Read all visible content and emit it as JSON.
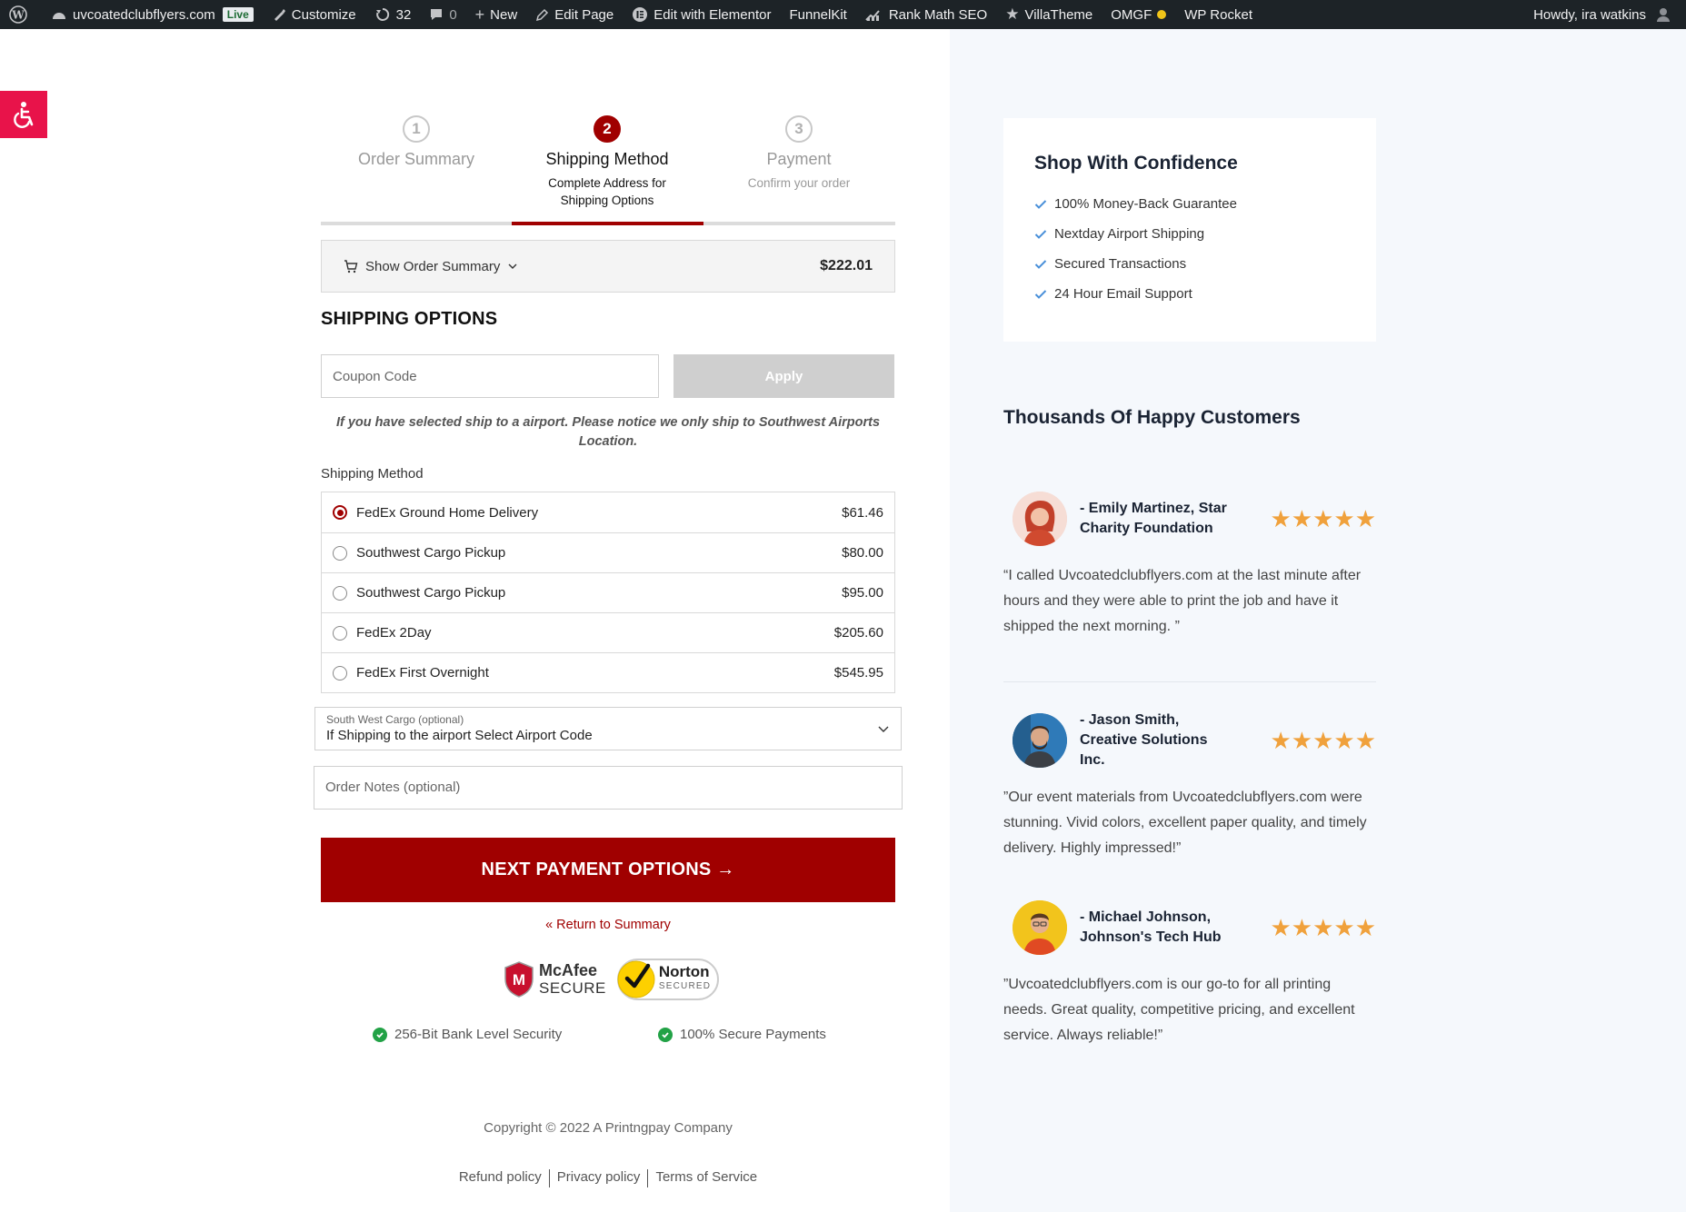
{
  "admin_bar": {
    "site_name": "uvcoatedclubflyers.com",
    "live_badge": "Live",
    "customize": "Customize",
    "updates_count": "32",
    "comments_count": "0",
    "new": "New",
    "edit_page": "Edit Page",
    "edit_elementor": "Edit with Elementor",
    "funnelkit": "FunnelKit",
    "rank_math": "Rank Math SEO",
    "villatheme": "VillaTheme",
    "omgf": "OMGF",
    "wp_rocket": "WP Rocket",
    "greeting": "Howdy, ira watkins"
  },
  "steps": [
    {
      "number": "1",
      "title": "Order Summary",
      "sub": ""
    },
    {
      "number": "2",
      "title": "Shipping Method",
      "sub_line1": "Complete Address for",
      "sub_line2": "Shipping Options"
    },
    {
      "number": "3",
      "title": "Payment",
      "sub": "Confirm your order"
    }
  ],
  "order_summary": {
    "label": "Show Order Summary",
    "total": "$222.01"
  },
  "shipping_heading": "SHIPPING OPTIONS",
  "coupon": {
    "placeholder": "Coupon Code",
    "apply_label": "Apply"
  },
  "airport_notice": {
    "line1": "If you have selected ship to a airport. Please notice we only ship to Southwest Airports",
    "line2": "Location."
  },
  "shipping_method_label": "Shipping Method",
  "shipping_options": [
    {
      "name": "FedEx Ground Home Delivery",
      "price": "$61.46",
      "selected": true
    },
    {
      "name": "Southwest Cargo Pickup",
      "price": "$80.00",
      "selected": false
    },
    {
      "name": "Southwest Cargo Pickup",
      "price": "$95.00",
      "selected": false
    },
    {
      "name": "FedEx 2Day",
      "price": "$205.60",
      "selected": false
    },
    {
      "name": "FedEx First Overnight",
      "price": "$545.95",
      "selected": false
    }
  ],
  "airport_select": {
    "label": "South West Cargo (optional)",
    "value": "If Shipping to the airport Select Airport Code"
  },
  "order_notes": {
    "placeholder": "Order Notes (optional)"
  },
  "next_button": "NEXT PAYMENT OPTIONS →",
  "return_link": "« Return to Summary",
  "badges": {
    "mcafee_line1": "McAfee",
    "mcafee_line2": "SECURE",
    "norton_line1": "Norton",
    "norton_line2": "SECURED"
  },
  "security": {
    "item1": "256-Bit Bank Level Security",
    "item2": "100% Secure Payments"
  },
  "footer": {
    "copyright": "Copyright © 2022 A Printngpay Company",
    "refund": "Refund policy",
    "privacy": "Privacy policy",
    "terms": "Terms of Service"
  },
  "confidence": {
    "title": "Shop With Confidence",
    "items": [
      "100% Money-Back Guarantee",
      "Nextday Airport Shipping",
      "Secured Transactions",
      "24 Hour Email Support"
    ]
  },
  "happy_heading": "Thousands Of  Happy Customers",
  "testimonials": [
    {
      "name_line1": "- Emily Martinez, Star",
      "name_line2": "Charity Foundation",
      "name_line3": "",
      "stars": "★★★★★",
      "rating": 5,
      "quote": "“I called Uvcoatedclubflyers.com at the last minute after hours and they were able to print the job and have it shipped the next morning. ”"
    },
    {
      "name_line1": "- Jason Smith,",
      "name_line2": "Creative Solutions",
      "name_line3": "Inc.",
      "stars": "★★★★★",
      "rating": 5,
      "quote": "”Our event materials from Uvcoatedclubflyers.com were stunning. Vivid colors, excellent paper quality, and timely delivery. Highly impressed!”"
    },
    {
      "name_line1": "- Michael Johnson,",
      "name_line2": "Johnson's Tech Hub",
      "name_line3": "",
      "stars": "★★★★★",
      "rating": 5,
      "quote": "”Uvcoatedclubflyers.com is our go-to for all printing needs. Great quality, competitive pricing, and excellent service. Always reliable!”"
    }
  ],
  "colors": {
    "brand_red": "#a00000",
    "admin_bar": "#1d2327",
    "accessibility": "#e8134a",
    "star": "#f0a13c",
    "right_panel_bg": "#f5f8fc",
    "check_blue": "#4a90d9",
    "secure_green": "#22a246"
  }
}
